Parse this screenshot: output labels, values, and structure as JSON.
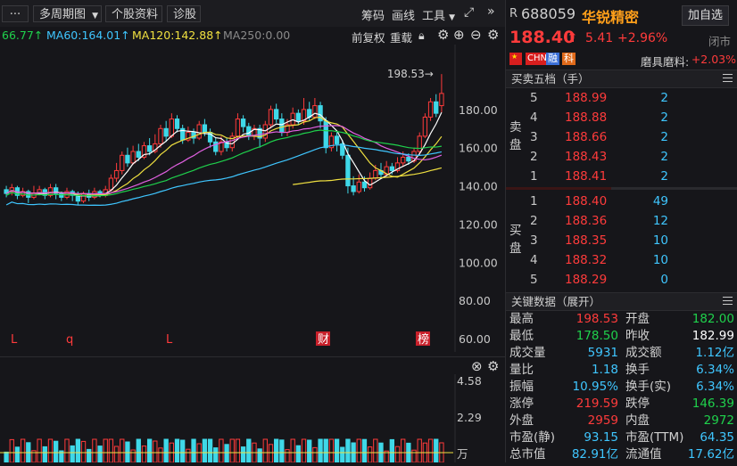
{
  "toolbar": {
    "more_label": "···",
    "period_label": "多周期图",
    "profile_label": "个股资料",
    "diagnose_label": "诊股",
    "chips_label": "筹码",
    "draw_label": "画线",
    "tools_label": "工具"
  },
  "ma_bar": {
    "ma_partial": "66.77↑",
    "ma60": "MA60:164.01↑",
    "ma120": "MA120:142.88↑",
    "ma250": "MA250:0.00",
    "adjust_label": "前复权",
    "overlay_label": "重载",
    "colors": {
      "ma60": "#3fc6ff",
      "ma120": "#f0e040",
      "ma250": "#8a8a8a",
      "ma_partial": "#1fd14c"
    }
  },
  "chart_data": {
    "type": "candlestick",
    "ylim": [
      60,
      200
    ],
    "y_ticks": [
      "180.00",
      "160.00",
      "140.00",
      "120.00",
      "100.00",
      "80.00",
      "60.00"
    ],
    "high_annotation": "198.53→",
    "markers": [
      "L",
      "q",
      "L",
      "财",
      "榜"
    ],
    "candles": [
      {
        "o": 138,
        "c": 136,
        "h": 140,
        "l": 134
      },
      {
        "o": 137,
        "c": 139,
        "h": 141,
        "l": 135
      },
      {
        "o": 139,
        "c": 135,
        "h": 140,
        "l": 133
      },
      {
        "o": 135,
        "c": 137,
        "h": 139,
        "l": 134
      },
      {
        "o": 137,
        "c": 134,
        "h": 138,
        "l": 131
      },
      {
        "o": 134,
        "c": 136,
        "h": 140,
        "l": 133
      },
      {
        "o": 136,
        "c": 138,
        "h": 140,
        "l": 135
      },
      {
        "o": 138,
        "c": 135,
        "h": 139,
        "l": 133
      },
      {
        "o": 135,
        "c": 139,
        "h": 141,
        "l": 134
      },
      {
        "o": 139,
        "c": 136,
        "h": 141,
        "l": 133
      },
      {
        "o": 136,
        "c": 134,
        "h": 137,
        "l": 132
      },
      {
        "o": 134,
        "c": 137,
        "h": 139,
        "l": 133
      },
      {
        "o": 137,
        "c": 135,
        "h": 138,
        "l": 132
      },
      {
        "o": 135,
        "c": 132,
        "h": 137,
        "l": 130
      },
      {
        "o": 132,
        "c": 136,
        "h": 137,
        "l": 131
      },
      {
        "o": 136,
        "c": 134,
        "h": 138,
        "l": 132
      },
      {
        "o": 134,
        "c": 137,
        "h": 139,
        "l": 133
      },
      {
        "o": 137,
        "c": 135,
        "h": 138,
        "l": 134
      },
      {
        "o": 135,
        "c": 138,
        "h": 140,
        "l": 134
      },
      {
        "o": 138,
        "c": 144,
        "h": 146,
        "l": 137
      },
      {
        "o": 144,
        "c": 148,
        "h": 152,
        "l": 142
      },
      {
        "o": 148,
        "c": 156,
        "h": 158,
        "l": 146
      },
      {
        "o": 156,
        "c": 152,
        "h": 160,
        "l": 150
      },
      {
        "o": 152,
        "c": 158,
        "h": 161,
        "l": 151
      },
      {
        "o": 158,
        "c": 155,
        "h": 162,
        "l": 153
      },
      {
        "o": 155,
        "c": 161,
        "h": 163,
        "l": 154
      },
      {
        "o": 161,
        "c": 158,
        "h": 165,
        "l": 156
      },
      {
        "o": 158,
        "c": 162,
        "h": 167,
        "l": 157
      },
      {
        "o": 162,
        "c": 170,
        "h": 172,
        "l": 160
      },
      {
        "o": 170,
        "c": 166,
        "h": 174,
        "l": 163
      },
      {
        "o": 166,
        "c": 175,
        "h": 178,
        "l": 165
      },
      {
        "o": 175,
        "c": 170,
        "h": 177,
        "l": 168
      },
      {
        "o": 170,
        "c": 164,
        "h": 172,
        "l": 162
      },
      {
        "o": 164,
        "c": 168,
        "h": 171,
        "l": 163
      },
      {
        "o": 168,
        "c": 165,
        "h": 170,
        "l": 162
      },
      {
        "o": 165,
        "c": 172,
        "h": 174,
        "l": 164
      },
      {
        "o": 172,
        "c": 168,
        "h": 175,
        "l": 166
      },
      {
        "o": 168,
        "c": 163,
        "h": 170,
        "l": 160
      },
      {
        "o": 163,
        "c": 158,
        "h": 165,
        "l": 156
      },
      {
        "o": 158,
        "c": 163,
        "h": 166,
        "l": 156
      },
      {
        "o": 163,
        "c": 160,
        "h": 165,
        "l": 158
      },
      {
        "o": 160,
        "c": 166,
        "h": 168,
        "l": 158
      },
      {
        "o": 166,
        "c": 175,
        "h": 178,
        "l": 164
      },
      {
        "o": 175,
        "c": 171,
        "h": 177,
        "l": 168
      },
      {
        "o": 171,
        "c": 166,
        "h": 173,
        "l": 164
      },
      {
        "o": 166,
        "c": 170,
        "h": 172,
        "l": 164
      },
      {
        "o": 170,
        "c": 165,
        "h": 172,
        "l": 160
      },
      {
        "o": 165,
        "c": 172,
        "h": 174,
        "l": 163
      },
      {
        "o": 172,
        "c": 180,
        "h": 182,
        "l": 170
      },
      {
        "o": 180,
        "c": 175,
        "h": 183,
        "l": 173
      },
      {
        "o": 175,
        "c": 168,
        "h": 178,
        "l": 166
      },
      {
        "o": 168,
        "c": 172,
        "h": 175,
        "l": 166
      },
      {
        "o": 172,
        "c": 178,
        "h": 181,
        "l": 170
      },
      {
        "o": 178,
        "c": 174,
        "h": 180,
        "l": 172
      },
      {
        "o": 174,
        "c": 180,
        "h": 186,
        "l": 172
      },
      {
        "o": 180,
        "c": 176,
        "h": 184,
        "l": 174
      },
      {
        "o": 176,
        "c": 182,
        "h": 186,
        "l": 175
      },
      {
        "o": 182,
        "c": 174,
        "h": 184,
        "l": 170
      },
      {
        "o": 174,
        "c": 160,
        "h": 176,
        "l": 157
      },
      {
        "o": 160,
        "c": 166,
        "h": 168,
        "l": 158
      },
      {
        "o": 166,
        "c": 162,
        "h": 168,
        "l": 158
      },
      {
        "o": 162,
        "c": 156,
        "h": 164,
        "l": 154
      },
      {
        "o": 156,
        "c": 140,
        "h": 160,
        "l": 136
      },
      {
        "o": 140,
        "c": 137,
        "h": 145,
        "l": 135
      },
      {
        "o": 137,
        "c": 142,
        "h": 146,
        "l": 136
      },
      {
        "o": 142,
        "c": 139,
        "h": 145,
        "l": 137
      },
      {
        "o": 139,
        "c": 144,
        "h": 147,
        "l": 138
      },
      {
        "o": 144,
        "c": 148,
        "h": 151,
        "l": 143
      },
      {
        "o": 148,
        "c": 146,
        "h": 152,
        "l": 144
      },
      {
        "o": 146,
        "c": 150,
        "h": 153,
        "l": 145
      },
      {
        "o": 150,
        "c": 148,
        "h": 152,
        "l": 146
      },
      {
        "o": 148,
        "c": 152,
        "h": 155,
        "l": 147
      },
      {
        "o": 152,
        "c": 155,
        "h": 158,
        "l": 150
      },
      {
        "o": 155,
        "c": 153,
        "h": 157,
        "l": 151
      },
      {
        "o": 153,
        "c": 158,
        "h": 160,
        "l": 152
      },
      {
        "o": 158,
        "c": 166,
        "h": 168,
        "l": 156
      },
      {
        "o": 166,
        "c": 176,
        "h": 178,
        "l": 165
      },
      {
        "o": 176,
        "c": 184,
        "h": 186,
        "l": 174
      },
      {
        "o": 184,
        "c": 178,
        "h": 188,
        "l": 176
      },
      {
        "o": 182,
        "c": 188.4,
        "h": 198.53,
        "l": 178.5
      }
    ]
  },
  "volume": {
    "ticks": [
      "4.58",
      "2.29",
      "万"
    ]
  },
  "quote": {
    "prefix": "R",
    "code": "688059",
    "name": "华锐精密",
    "add_watch_label": "加自选",
    "price": "188.40",
    "change": "5.41",
    "change_pct": "+2.96%",
    "status": "闭市",
    "tags": [
      "CHN",
      "融",
      "科"
    ],
    "margin_label": "磨具磨料:",
    "margin_value": "+2.03%"
  },
  "orderbook": {
    "title": "买卖五档（手）",
    "sell_label": [
      "卖",
      "盘"
    ],
    "buy_label": [
      "买",
      "盘"
    ],
    "asks": [
      {
        "idx": "5",
        "price": "188.99",
        "vol": "2"
      },
      {
        "idx": "4",
        "price": "188.88",
        "vol": "2"
      },
      {
        "idx": "3",
        "price": "188.66",
        "vol": "2"
      },
      {
        "idx": "2",
        "price": "188.43",
        "vol": "2"
      },
      {
        "idx": "1",
        "price": "188.41",
        "vol": "2"
      }
    ],
    "bids": [
      {
        "idx": "1",
        "price": "188.40",
        "vol": "49"
      },
      {
        "idx": "2",
        "price": "188.36",
        "vol": "12"
      },
      {
        "idx": "3",
        "price": "188.35",
        "vol": "10"
      },
      {
        "idx": "4",
        "price": "188.32",
        "vol": "10"
      },
      {
        "idx": "5",
        "price": "188.29",
        "vol": "0"
      }
    ]
  },
  "key_data": {
    "title": "关键数据（展开）",
    "rows": [
      {
        "l": "最高",
        "lv": "198.53",
        "lc": "red",
        "r": "开盘",
        "rv": "182.00",
        "rc": "green"
      },
      {
        "l": "最低",
        "lv": "178.50",
        "lc": "green",
        "r": "昨收",
        "rv": "182.99",
        "rc": "white"
      },
      {
        "l": "成交量",
        "lv": "5931",
        "lc": "cyan",
        "r": "成交额",
        "rv": "1.12亿",
        "rc": "cyan"
      },
      {
        "l": "量比",
        "lv": "1.18",
        "lc": "cyan",
        "r": "换手",
        "rv": "6.34%",
        "rc": "cyan"
      },
      {
        "l": "振幅",
        "lv": "10.95%",
        "lc": "cyan",
        "r": "换手(实)",
        "rv": "6.34%",
        "rc": "cyan"
      },
      {
        "l": "涨停",
        "lv": "219.59",
        "lc": "red",
        "r": "跌停",
        "rv": "146.39",
        "rc": "green"
      },
      {
        "l": "外盘",
        "lv": "2959",
        "lc": "red",
        "r": "内盘",
        "rv": "2972",
        "rc": "green"
      },
      {
        "l": "市盈(静)",
        "lv": "93.15",
        "lc": "cyan",
        "r": "市盈(TTM)",
        "rv": "64.35",
        "rc": "cyan"
      },
      {
        "l": "总市值",
        "lv": "82.91亿",
        "lc": "cyan",
        "r": "流通值",
        "rv": "17.62亿",
        "rc": "cyan"
      }
    ]
  }
}
